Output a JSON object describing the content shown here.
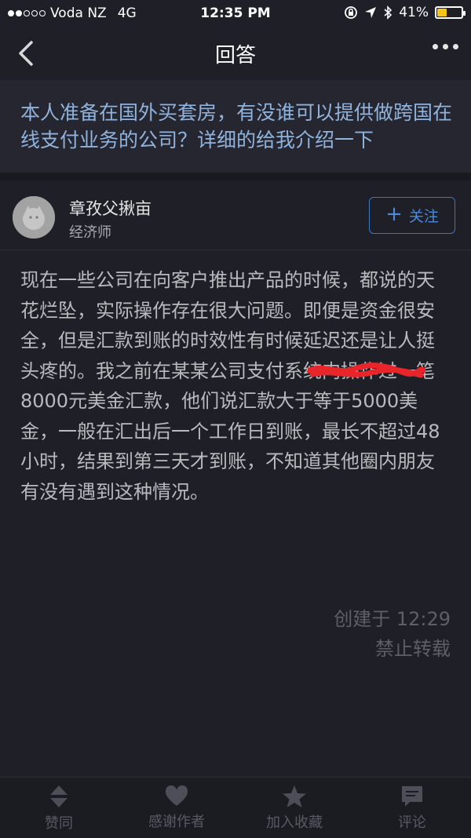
{
  "status_bar": {
    "carrier": "Voda NZ",
    "network": "4G",
    "time": "12:35 PM",
    "battery": "41%",
    "battery_level": 0.41,
    "signal_bars_filled": 2,
    "signal_bars_total": 5
  },
  "nav": {
    "title": "回答",
    "back_icon": "chevron-left-icon",
    "more_icon": "more-dots-icon"
  },
  "question": {
    "title": "本人准备在国外买套房，有没谁可以提供做跨国在线支付业务的公司？详细的给我介绍一下"
  },
  "author": {
    "name": "章孜父揪亩",
    "role": "经济师",
    "follow_label": "关注"
  },
  "answer": {
    "body": "现在一些公司在向客户推出产品的时候，都说的天花烂坠，实际操作存在很大问题。即便是资金很安全，但是汇款到账的时效性有时候延迟还是让人挺头疼的。我之前在某某公司支付系统内操作过一笔8000元美金汇款，他们说汇款大于等于5000美金，一般在汇出后一个工作日到账，最长不超过48小时，结果到第三天才到账，不知道其他圈内朋友有没有遇到这种情况。"
  },
  "meta": {
    "created": "创建于 12:29",
    "copyright": "禁止转载"
  },
  "bottom_bar": {
    "items": [
      {
        "label": "赞同",
        "icon": "vote-arrows-icon"
      },
      {
        "label": "感谢作者",
        "icon": "heart-icon"
      },
      {
        "label": "加入收藏",
        "icon": "star-icon"
      },
      {
        "label": "评论",
        "icon": "comment-icon"
      }
    ]
  },
  "colors": {
    "background": "#1f1f28",
    "question_text": "#8fb3dc",
    "accent": "#3a78c4",
    "redaction": "#e8262a"
  }
}
